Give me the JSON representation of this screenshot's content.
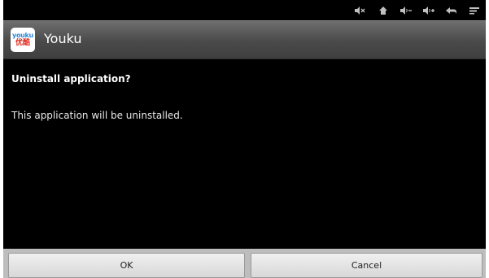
{
  "status_bar": {
    "icons": [
      "volume-mute-icon",
      "home-icon",
      "volume-down-icon",
      "volume-up-icon",
      "back-icon",
      "menu-icon"
    ]
  },
  "app": {
    "logo_text_top": "youku",
    "logo_text_bottom": "优酷",
    "title": "Youku"
  },
  "dialog": {
    "title": "Uninstall application?",
    "message": "This application will be uninstalled.",
    "ok_label": "OK",
    "cancel_label": "Cancel"
  },
  "colors": {
    "background": "#000000",
    "titlebar": "#4a4a4a",
    "button": "#e4e4e4"
  }
}
